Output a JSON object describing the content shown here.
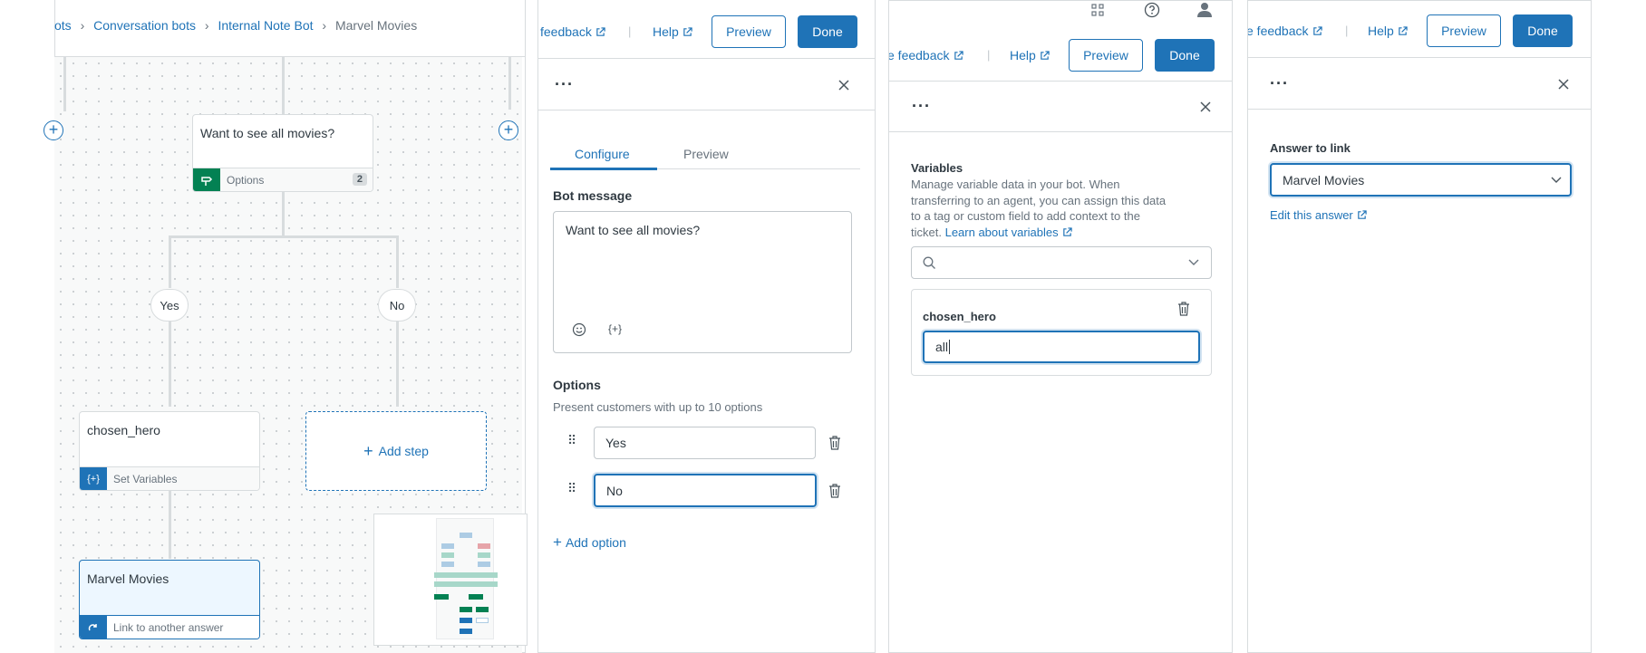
{
  "colors": {
    "accent": "#1f73b7",
    "green": "#038153",
    "canvas": "#f8f9f9"
  },
  "panel1": {
    "breadcrumb": {
      "item0": "ots",
      "item1": "Conversation bots",
      "item2": "Internal Note Bot",
      "current": "Marvel Movies"
    },
    "nodes": {
      "question": {
        "title": "Want to see all movies?",
        "footer": "Options",
        "count": "2"
      },
      "yes": "Yes",
      "no": "No",
      "variables": {
        "title": "chosen_hero",
        "footer": "Set Variables"
      },
      "add_step": "Add step",
      "link": {
        "title": "Marvel Movies",
        "footer": "Link to another answer"
      }
    }
  },
  "panel2": {
    "header": {
      "feedback": "feedback",
      "help": "Help",
      "preview": "Preview",
      "done": "Done"
    },
    "tabs": {
      "configure": "Configure",
      "preview": "Preview"
    },
    "bot_message_label": "Bot message",
    "bot_message_value": "Want to see all movies?",
    "options_label": "Options",
    "options_hint": "Present customers with up to 10 options",
    "option1": "Yes",
    "option2": "No",
    "add_option": "Add option"
  },
  "panel3": {
    "header": {
      "feedback": "e feedback",
      "help": "Help",
      "preview": "Preview",
      "done": "Done"
    },
    "variables_label": "Variables",
    "desc_line1": "Manage variable data in your bot. When",
    "desc_line2": "transferring to an agent, you can assign this data",
    "desc_line3": "to a tag or custom field to add context to the",
    "desc_line4": "ticket.",
    "learn_link": "Learn about variables",
    "var_name": "chosen_hero",
    "var_value": "all"
  },
  "panel4": {
    "header": {
      "feedback": "e feedback",
      "help": "Help",
      "preview": "Preview",
      "done": "Done"
    },
    "answer_label": "Answer to link",
    "answer_value": "Marvel Movies",
    "edit_link": "Edit this answer"
  }
}
